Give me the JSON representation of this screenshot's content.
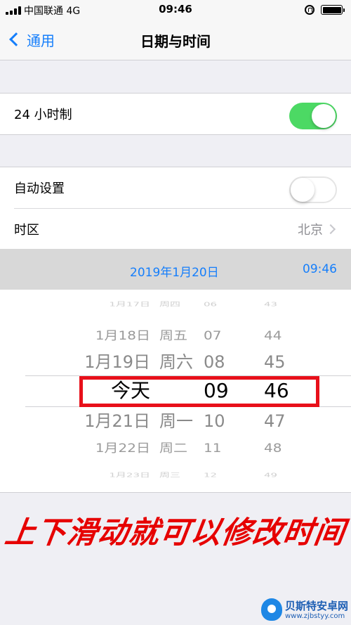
{
  "status_bar": {
    "carrier": "中国联通  4G",
    "time": "09:46"
  },
  "nav": {
    "back_label": "通用",
    "title": "日期与时间"
  },
  "settings": {
    "hour24_label": "24 小时制",
    "hour24_on": true,
    "auto_label": "自动设置",
    "auto_on": false,
    "timezone_label": "时区",
    "timezone_value": "北京"
  },
  "date_time": {
    "date": "2019年1月20日",
    "time": "09:46"
  },
  "picker": {
    "rows": [
      {
        "date": "1月17日",
        "week": "周四",
        "hour": "06",
        "minute": "43"
      },
      {
        "date": "1月18日",
        "week": "周五",
        "hour": "07",
        "minute": "44"
      },
      {
        "date": "1月19日",
        "week": "周六",
        "hour": "08",
        "minute": "45"
      },
      {
        "date": "今天",
        "week": "",
        "hour": "09",
        "minute": "46"
      },
      {
        "date": "1月21日",
        "week": "周一",
        "hour": "10",
        "minute": "47"
      },
      {
        "date": "1月22日",
        "week": "周二",
        "hour": "11",
        "minute": "48"
      },
      {
        "date": "1月23日",
        "week": "周三",
        "hour": "12",
        "minute": "49"
      }
    ]
  },
  "caption": "上下滑动就可以修改时间",
  "watermark": {
    "name": "贝斯特安卓网",
    "url": "www.zjbstyy.com"
  },
  "colors": {
    "accent": "#157efb",
    "toggle_on": "#4cd964",
    "highlight": "#e8101a",
    "caption": "#e60000"
  }
}
